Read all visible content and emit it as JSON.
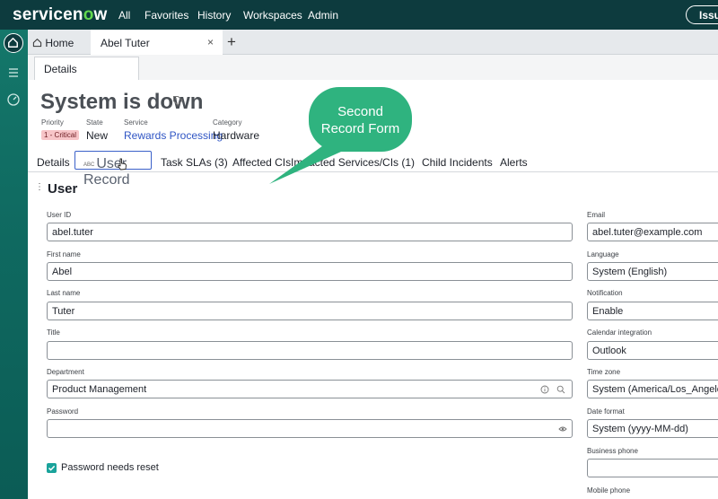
{
  "nav": {
    "logo_pre": "servicen",
    "logo_o": "o",
    "logo_post": "w",
    "items": [
      "All",
      "Favorites",
      "History",
      "Workspaces",
      "Admin"
    ],
    "issue_button": "Issue"
  },
  "tabs": {
    "home": "Home",
    "record": "Abel Tuter",
    "close_glyph": "×",
    "add_glyph": "+"
  },
  "subtabs": {
    "details": "Details"
  },
  "record": {
    "title": "System is down",
    "priority_label": "Priority",
    "priority_value": "1 - Critical",
    "state_label": "State",
    "state_value": "New",
    "service_label": "Service",
    "service_value": "Rewards Processing",
    "category_label": "Category",
    "category_value": "Hardware"
  },
  "form_tabs": {
    "details": "Details",
    "user_record_abc": "ABC",
    "user_record": "User Record",
    "task_slas": "Task SLAs (3)",
    "affected_cis": "Affected CIs",
    "impacted": "Impacted Services/CIs (1)",
    "child_incidents": "Child Incidents",
    "alerts": "Alerts"
  },
  "section": {
    "handle": "⋮",
    "title": "User"
  },
  "fields_left": {
    "user_id_label": "User ID",
    "user_id_value": "abel.tuter",
    "first_name_label": "First name",
    "first_name_value": "Abel",
    "last_name_label": "Last name",
    "last_name_value": "Tuter",
    "title_label": "Title",
    "title_value": "",
    "department_label": "Department",
    "department_value": "Product Management",
    "password_label": "Password",
    "password_value": "",
    "password_reset_label": "Password needs reset"
  },
  "fields_right": {
    "email_label": "Email",
    "email_value": "abel.tuter@example.com",
    "language_label": "Language",
    "language_value": "System (English)",
    "notification_label": "Notification",
    "notification_value": "Enable",
    "calendar_label": "Calendar integration",
    "calendar_value": "Outlook",
    "timezone_label": "Time zone",
    "timezone_value": "System (America/Los_Angeles)",
    "date_format_label": "Date format",
    "date_format_value": "System (yyyy-MM-dd)",
    "business_phone_label": "Business phone",
    "business_phone_value": "",
    "mobile_phone_label": "Mobile phone"
  },
  "callout": {
    "line1": "Second",
    "line2": "Record Form"
  },
  "colors": {
    "nav_bg": "#0d3b3e",
    "rail_bg": "#0f6960",
    "accent_green": "#62d84e",
    "callout": "#2fb37f",
    "link": "#2f55c4",
    "critical_badge": "#f7c5c8",
    "checkbox": "#1aa39b"
  },
  "icons": [
    "home-icon",
    "list-icon",
    "dashboard-icon",
    "tag-icon",
    "info-icon",
    "search-icon",
    "eye-icon",
    "checkmark-icon",
    "cursor-hand-icon"
  ]
}
